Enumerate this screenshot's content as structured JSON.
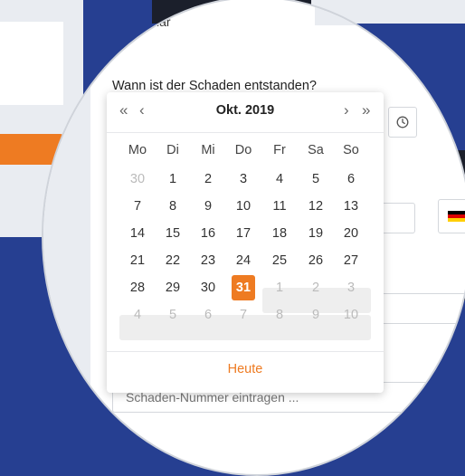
{
  "page": {
    "top_text": "…klar"
  },
  "form": {
    "question": "Wann ist der Schaden entstanden?",
    "schaden_placeholder": "Schaden-Nummer eintragen ..."
  },
  "calendar": {
    "prev_year": "«",
    "prev_month": "‹",
    "month_label": "Okt. 2019",
    "next_month": "›",
    "next_year": "»",
    "weekdays": [
      "Mo",
      "Di",
      "Mi",
      "Do",
      "Fr",
      "Sa",
      "So"
    ],
    "days": [
      [
        "30",
        "1",
        "2",
        "3",
        "4",
        "5",
        "6"
      ],
      [
        "7",
        "8",
        "9",
        "10",
        "11",
        "12",
        "13"
      ],
      [
        "14",
        "15",
        "16",
        "17",
        "18",
        "19",
        "20"
      ],
      [
        "21",
        "22",
        "23",
        "24",
        "25",
        "26",
        "27"
      ],
      [
        "28",
        "29",
        "30",
        "31",
        "1",
        "2",
        "3"
      ],
      [
        "4",
        "5",
        "6",
        "7",
        "8",
        "9",
        "10"
      ]
    ],
    "selected_day": "31",
    "today_button": "Heute"
  },
  "colors": {
    "accent": "#ee7b22",
    "background_blue": "#263f91",
    "flag": [
      "#000000",
      "#dd0000",
      "#ffce00"
    ]
  },
  "icons": {
    "clock": "clock-icon",
    "flag": "germany-flag-icon"
  }
}
